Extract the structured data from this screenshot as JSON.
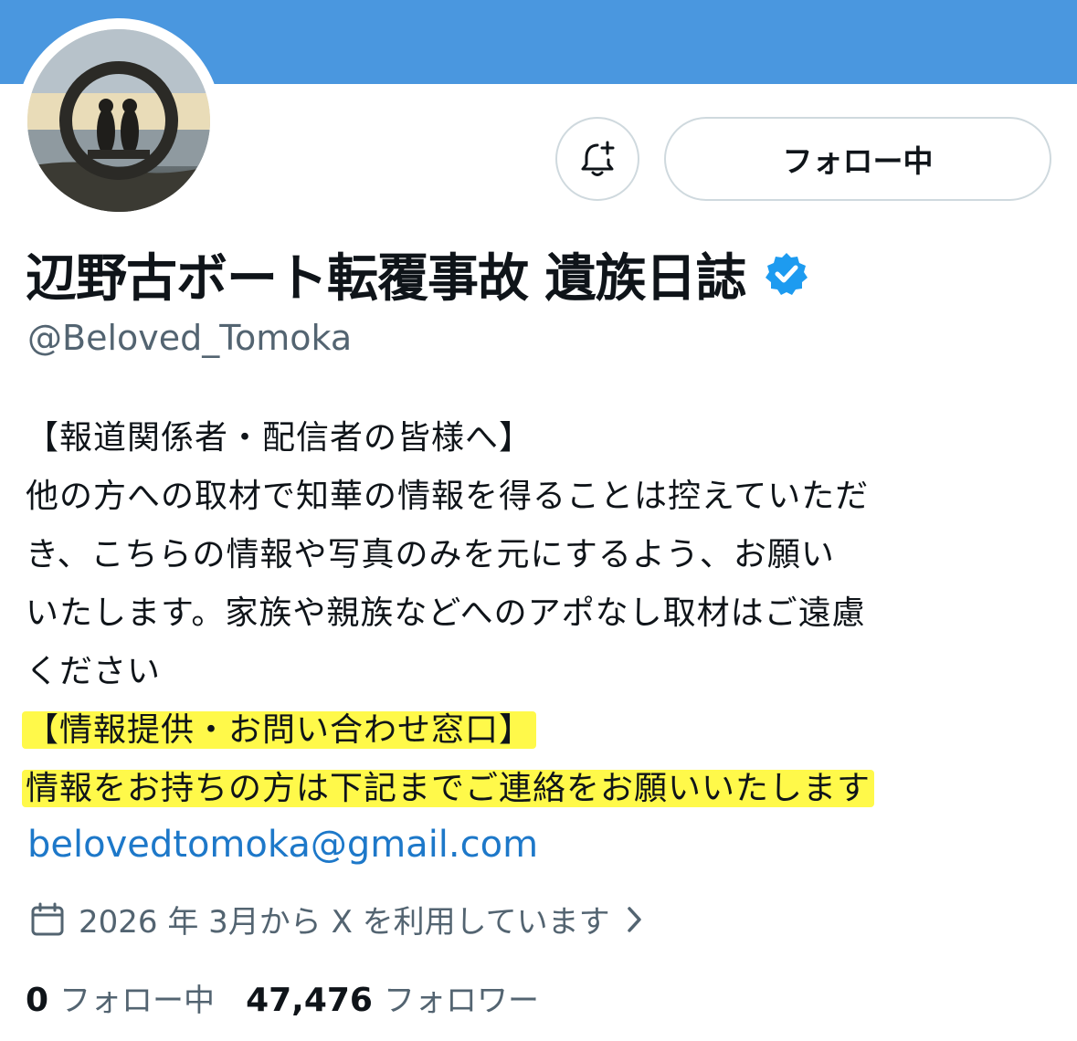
{
  "colors": {
    "banner": "#4a97df",
    "highlight": "#fff94a",
    "link": "#1d78c9",
    "verified": "#1d9bf0",
    "muted": "#536471"
  },
  "buttons": {
    "notify_icon": "bell-plus-icon",
    "follow_label": "フォロー中"
  },
  "profile": {
    "display_name": "辺野古ボート転覆事故 遺族日誌",
    "verified_icon": "verified-badge-icon",
    "handle": "@Beloved_Tomoka",
    "bio_lines": [
      "【報道関係者・配信者の皆様へ】",
      "他の方への取材で知華の情報を得ることは控えていただ",
      "き、こちらの情報や写真のみを元にするよう、お願い",
      "いたします。家族や親族などへのアポなし取材はご遠慮",
      "ください"
    ],
    "highlighted_lines": [
      "【情報提供・お問い合わせ窓口】",
      "情報をお持ちの方は下記までご連絡をお願いいたします"
    ],
    "email": "belovedtomoka@gmail.com",
    "joined_icon": "calendar-icon",
    "joined_text": "2026 年 3月から X を利用しています",
    "following_count": "0",
    "following_label": "フォロー中",
    "followers_count": "47,476",
    "followers_label": "フォロワー"
  }
}
